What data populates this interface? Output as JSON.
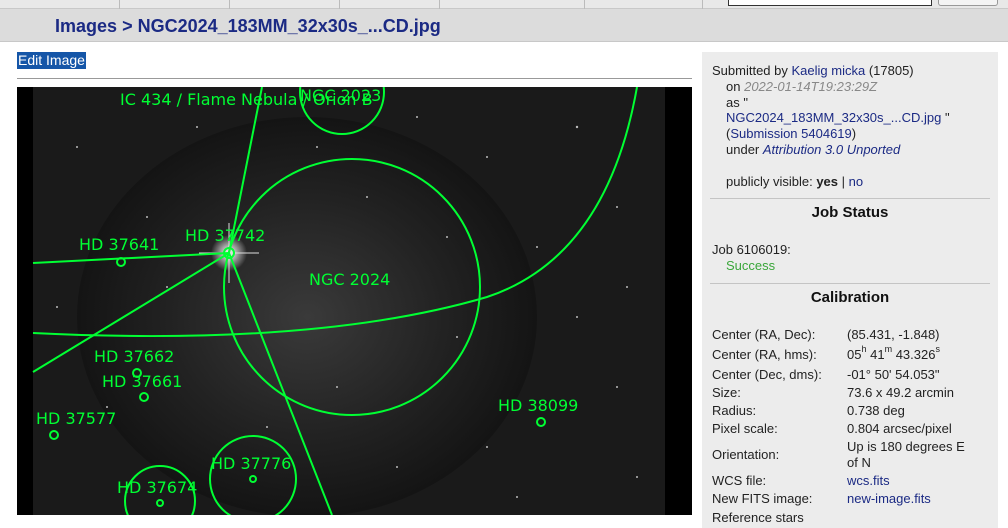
{
  "breadcrumb": {
    "root": "Images",
    "separator": ">",
    "current": "NGC2024_183MM_32x30s_...CD.jpg"
  },
  "edit_image_label": "Edit Image",
  "annotation_color": "#00ff33",
  "annotations": [
    {
      "label": "IC 434 / Flame Nebula / Orion B",
      "kind": "region"
    },
    {
      "label": "NGC 2023",
      "kind": "circle"
    },
    {
      "label": "NGC 2024",
      "kind": "circle"
    },
    {
      "label": "HD 37641",
      "kind": "star"
    },
    {
      "label": "HD 37742",
      "kind": "star"
    },
    {
      "label": "HD 37662",
      "kind": "star"
    },
    {
      "label": "HD 37661",
      "kind": "star"
    },
    {
      "label": "HD 37577",
      "kind": "star"
    },
    {
      "label": "HD 38099",
      "kind": "star"
    },
    {
      "label": "HD 37776",
      "kind": "circle"
    },
    {
      "label": "HD 37674",
      "kind": "circle"
    }
  ],
  "submission": {
    "submitted_by_label": "Submitted by",
    "user": "Kaelig micka",
    "user_count": "(17805)",
    "on_label": "on",
    "date": "2022-01-14T19:23:29Z",
    "as_label": "as \"",
    "filename": "NGC2024_183MM_32x30s_...CD.jpg",
    "filename_suffix": "\"",
    "submission_link": "Submission 5404619",
    "under_label": "under",
    "license": "Attribution 3.0 Unported",
    "visibility_label": "publicly visible:",
    "visibility_yes": "yes",
    "visibility_sep": "|",
    "visibility_no": "no"
  },
  "job_status": {
    "heading": "Job Status",
    "job_label": "Job 6106019:",
    "status": "Success"
  },
  "calibration": {
    "heading": "Calibration",
    "rows": [
      {
        "label": "Center (RA, Dec):",
        "value": "(85.431, -1.848)"
      },
      {
        "label": "Center (RA, hms):",
        "value": "05h 41m 43.326s"
      },
      {
        "label": "Center (Dec, dms):",
        "value": "-01° 50' 54.053\""
      },
      {
        "label": "Size:",
        "value": "73.6 x 49.2 arcmin"
      },
      {
        "label": "Radius:",
        "value": "0.738 deg"
      },
      {
        "label": "Pixel scale:",
        "value": "0.804 arcsec/pixel"
      },
      {
        "label": "Orientation:",
        "value": "Up is 180 degrees E of N"
      },
      {
        "label": "WCS file:",
        "value": "wcs.fits"
      },
      {
        "label": "New FITS image:",
        "value": "new-image.fits"
      },
      {
        "label": "Reference stars",
        "value": ""
      }
    ],
    "ra_hms": {
      "h": "05",
      "m": "41",
      "s": "43.326",
      "h_unit": "h",
      "m_unit": "m",
      "s_unit": "s"
    },
    "orientation_line1": "Up is 180 degrees E",
    "orientation_line2": "of N"
  }
}
